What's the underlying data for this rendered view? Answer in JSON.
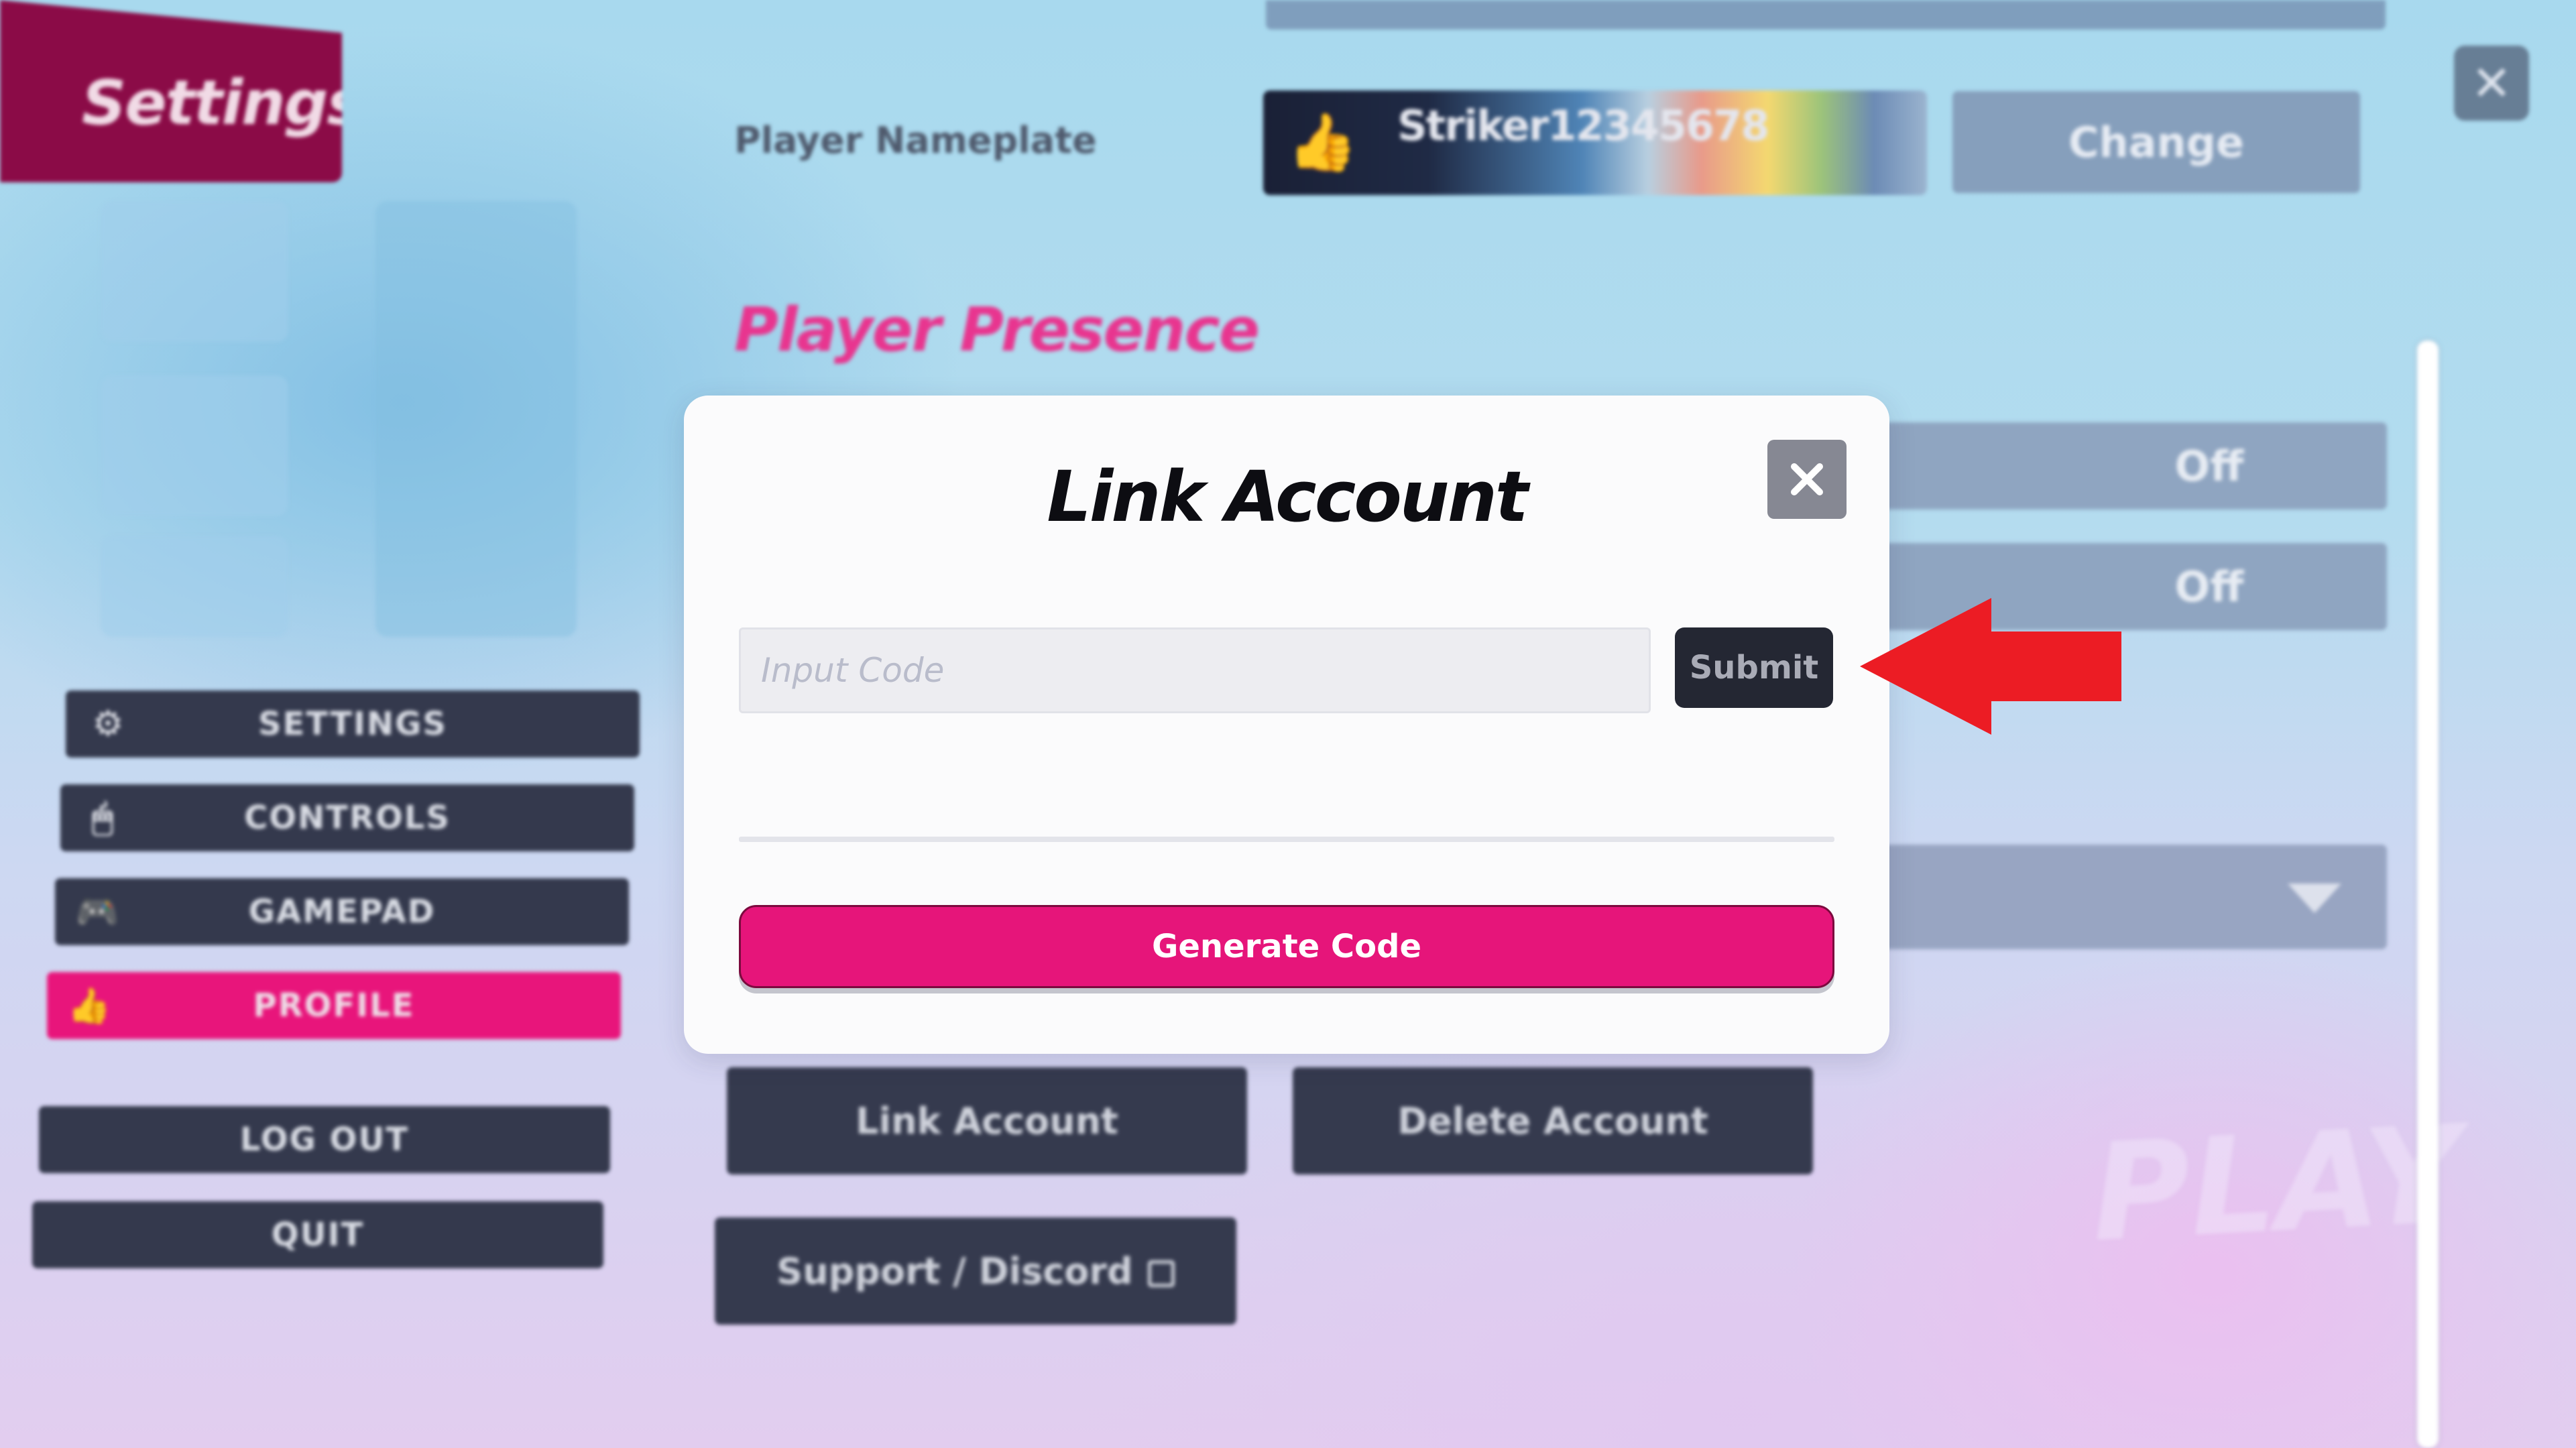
{
  "header": {
    "title": "Settings",
    "close_icon": "close-icon"
  },
  "profile": {
    "nameplate_label": "Player Nameplate",
    "nameplate_name": "Striker12345678",
    "nameplate_icon": "thumbs-up-icon",
    "change_label": "Change",
    "presence_heading": "Player Presence",
    "toggles": [
      {
        "value": "Off"
      },
      {
        "value": "Off"
      }
    ],
    "dropdown_icon": "chevron-down-icon",
    "account_buttons": {
      "link_account": "Link Account",
      "delete_account": "Delete Account",
      "support_discord": "Support / Discord"
    },
    "background_watermark": "PLAY"
  },
  "sidebar": {
    "items": [
      {
        "label": "SETTINGS",
        "icon": "gear-icon",
        "active": false
      },
      {
        "label": "CONTROLS",
        "icon": "mouse-icon",
        "active": false
      },
      {
        "label": "GAMEPAD",
        "icon": "gamepad-icon",
        "active": false
      },
      {
        "label": "PROFILE",
        "icon": "thumbs-up-icon",
        "active": true
      }
    ],
    "log_out": "LOG OUT",
    "quit": "QUIT"
  },
  "modal": {
    "title": "Link Account",
    "input_placeholder": "Input Code",
    "input_value": "",
    "submit_label": "Submit",
    "generate_label": "Generate Code"
  },
  "colors": {
    "accent_pink": "#e6157a",
    "banner_maroon": "#8b0b47",
    "dark_button": "#34394d",
    "annotation_red": "#ec1c24"
  }
}
